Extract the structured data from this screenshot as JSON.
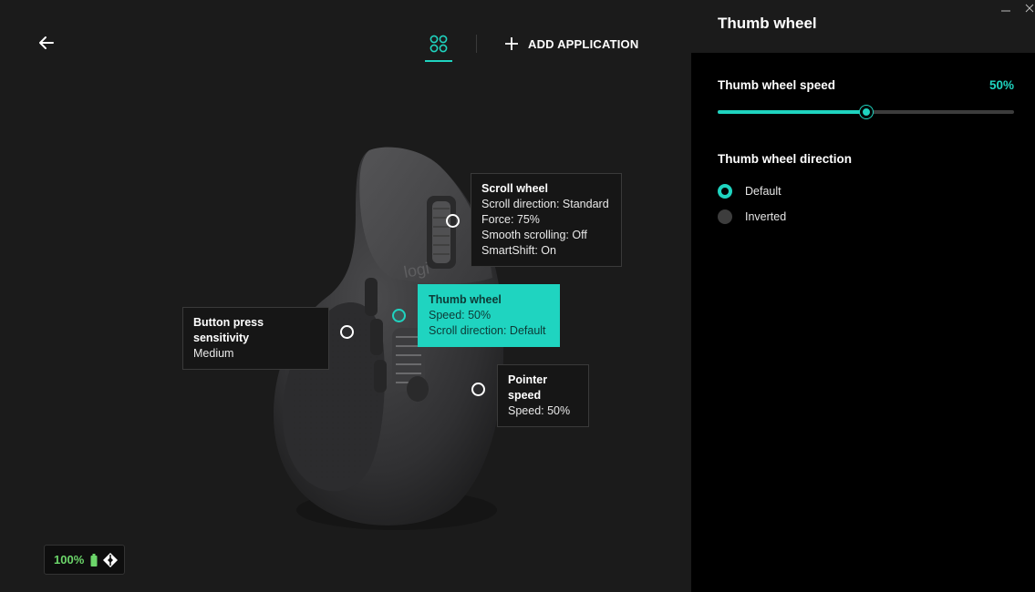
{
  "topbar": {
    "add_application_label": "ADD APPLICATION"
  },
  "callouts": {
    "scroll_wheel": {
      "title": "Scroll wheel",
      "lines": [
        "Scroll direction: Standard",
        "Force: 75%",
        "Smooth scrolling: Off",
        "SmartShift: On"
      ]
    },
    "thumb_wheel": {
      "title": "Thumb wheel",
      "lines": [
        "Speed: 50%",
        "Scroll direction: Default"
      ]
    },
    "button_press": {
      "title": "Button press sensitivity",
      "lines": [
        "Medium"
      ]
    },
    "pointer_speed": {
      "title": "Pointer speed",
      "lines": [
        "Speed: 50%"
      ]
    }
  },
  "mouse_logo": "logi",
  "battery": {
    "percent_label": "100%"
  },
  "panel": {
    "title": "Thumb wheel",
    "speed_label": "Thumb wheel speed",
    "speed_value_label": "50%",
    "speed_fraction": 0.5,
    "direction_label": "Thumb wheel direction",
    "direction_options": [
      {
        "label": "Default",
        "selected": true
      },
      {
        "label": "Inverted",
        "selected": false
      }
    ]
  },
  "colors": {
    "accent": "#1fd4c0",
    "battery_green": "#6cd66a"
  }
}
